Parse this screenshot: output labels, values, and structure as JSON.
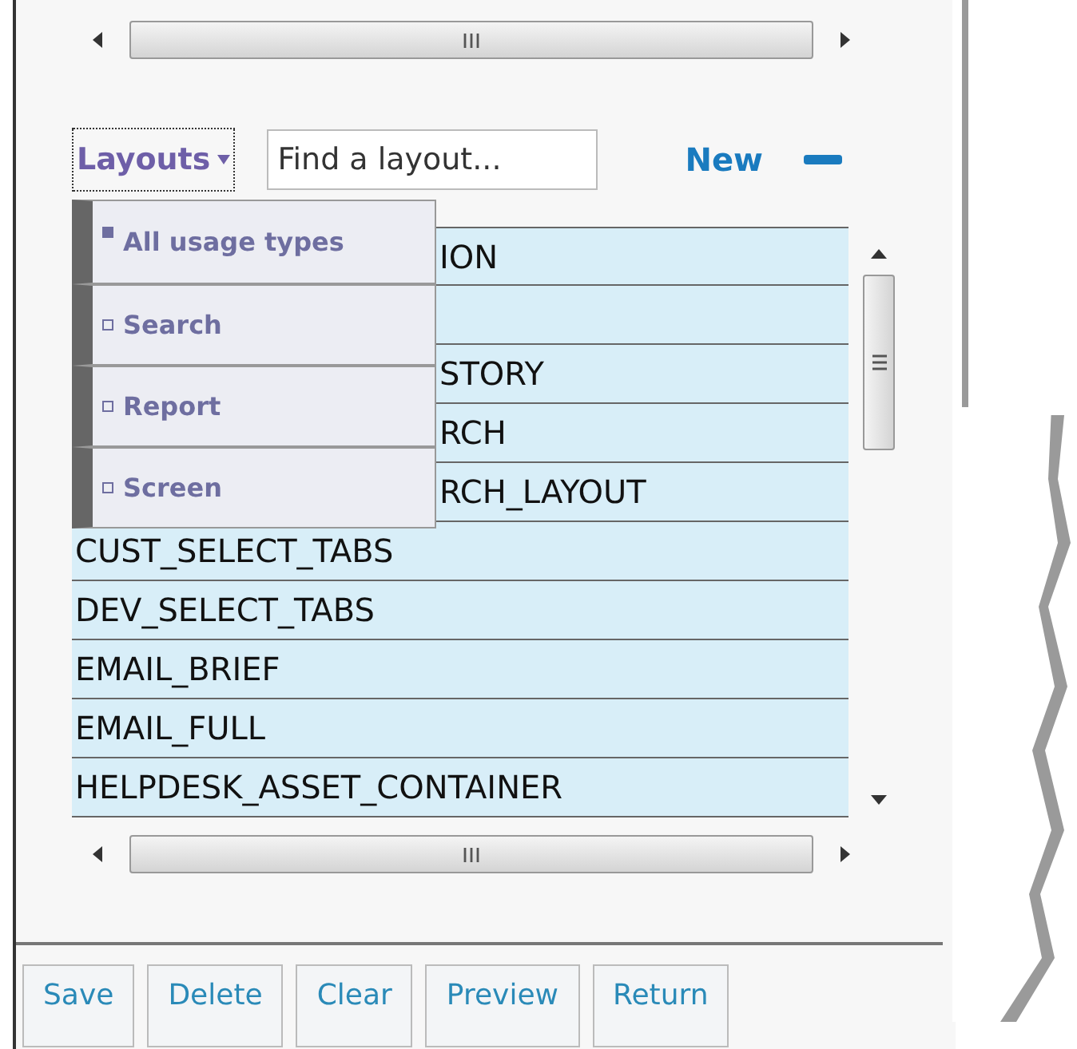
{
  "layouts_menu": {
    "label": "Layouts",
    "search": {
      "placeholder": "Find a layout..."
    },
    "new_button": "New",
    "usage_types": [
      {
        "label": "All usage types",
        "selected": true
      },
      {
        "label": "Search",
        "selected": false
      },
      {
        "label": "Report",
        "selected": false
      },
      {
        "label": "Screen",
        "selected": false
      }
    ]
  },
  "layout_list": {
    "rows": [
      {
        "text": "ION"
      },
      {},
      {
        "text": "STORY"
      },
      {
        "text": "RCH"
      },
      {
        "text": "RCH_LAYOUT"
      },
      {
        "text": "CUST_SELECT_TABS"
      },
      {
        "text": "DEV_SELECT_TABS"
      },
      {
        "text": "EMAIL_BRIEF"
      },
      {
        "text": "EMAIL_FULL"
      },
      {
        "text": "HELPDESK_ASSET_CONTAINER"
      }
    ]
  },
  "buttons": [
    "Save",
    "Delete",
    "Clear",
    "Preview",
    "Return"
  ]
}
